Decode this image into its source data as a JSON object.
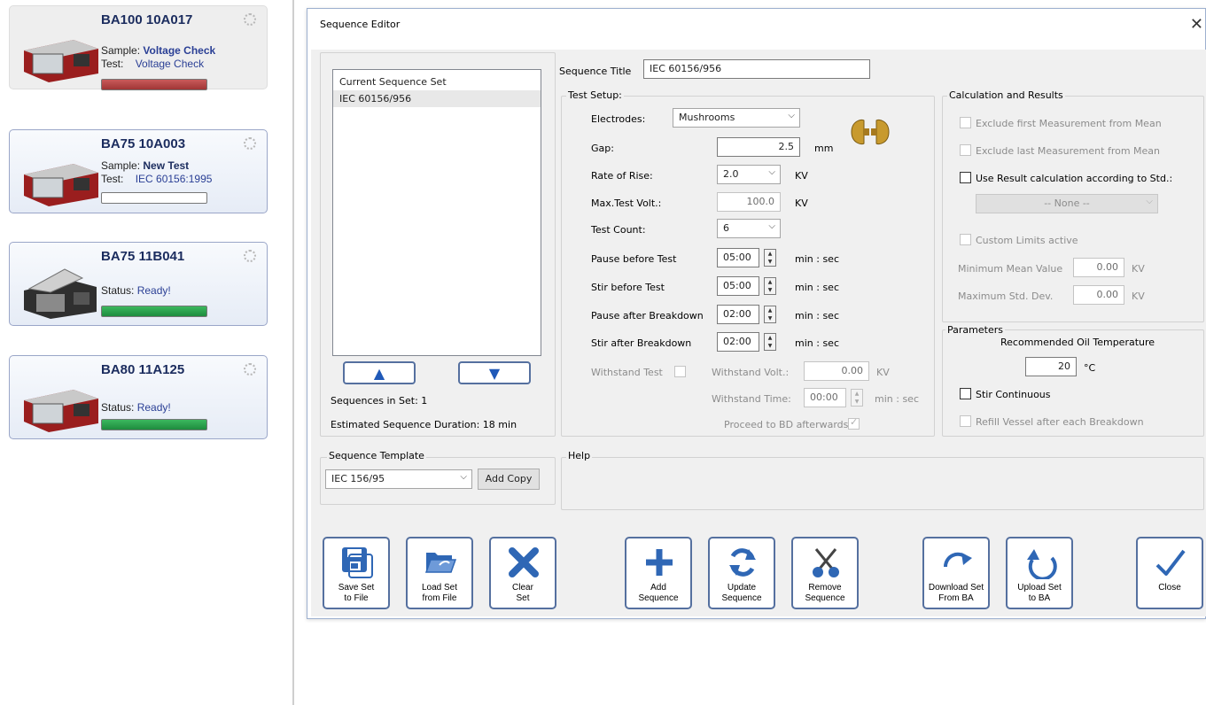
{
  "devices": [
    {
      "name": "BA100 10A017",
      "line1_label": "Sample:",
      "line1_value": "Voltage Check",
      "line2_label": "Test:",
      "line2_value": "Voltage Check",
      "status_color": "#b04040"
    },
    {
      "name": "BA75 10A003",
      "line1_label": "Sample:",
      "line1_value": "New Test",
      "line2_label": "Test:",
      "line2_value": "IEC 60156:1995",
      "status_color": "#ffffff"
    },
    {
      "name": "BA75 11B041",
      "status_label": "Status:",
      "status_value": "Ready!",
      "status_color": "#27a24a"
    },
    {
      "name": "BA80 11A125",
      "status_label": "Status:",
      "status_value": "Ready!",
      "status_color": "#27a24a"
    }
  ],
  "dialog": {
    "title": "Sequence Editor",
    "close_glyph": "✕",
    "list": {
      "header": "Current Sequence Set",
      "items": [
        "IEC 60156/956"
      ],
      "sequences_in_set": "Sequences in Set:  1",
      "estimated_duration": "Estimated Sequence Duration: 18 min"
    },
    "template": {
      "legend": "Sequence Template",
      "selected": "IEC 156/95",
      "add_copy": "Add Copy"
    },
    "sequence_title_label": "Sequence Title",
    "sequence_title_value": "IEC 60156/956",
    "test_setup": {
      "legend": "Test Setup:",
      "electrodes_label": "Electrodes:",
      "electrodes_value": "Mushrooms",
      "gap_label": "Gap:",
      "gap_value": "2.5",
      "gap_unit": "mm",
      "rate_label": "Rate of Rise:",
      "rate_value": "2.0",
      "rate_unit": "KV",
      "maxvolt_label": "Max.Test Volt.:",
      "maxvolt_value": "100.0",
      "maxvolt_unit": "KV",
      "count_label": "Test Count:",
      "count_value": "6",
      "pause_before_label": "Pause before Test",
      "pause_before_value": "05:00",
      "stir_before_label": "Stir before Test",
      "stir_before_value": "05:00",
      "pause_after_label": "Pause after Breakdown",
      "pause_after_value": "02:00",
      "stir_after_label": "Stir after Breakdown",
      "stir_after_value": "02:00",
      "time_unit": "min : sec",
      "withstand_label": "Withstand Test",
      "withstand_volt_label": "Withstand Volt.:",
      "withstand_volt_value": "0.00",
      "withstand_volt_unit": "KV",
      "withstand_time_label": "Withstand Time:",
      "withstand_time_value": "00:00",
      "withstand_time_unit": "min : sec",
      "proceed_label": "Proceed to BD afterwards"
    },
    "calc": {
      "legend": "Calculation and Results",
      "exclude_first": "Exclude first Measurement from Mean",
      "exclude_last": "Exclude last Measurement from Mean",
      "use_std": "Use Result calculation according to Std.:",
      "std_value": "-- None --",
      "custom_limits": "Custom Limits active",
      "min_mean_label": "Minimum Mean Value",
      "min_mean_value": "0.00",
      "max_std_label": "Maximum Std. Dev.",
      "max_std_value": "0.00",
      "unit": "KV"
    },
    "params": {
      "legend": "Parameters",
      "oil_temp_label": "Recommended Oil Temperature",
      "oil_temp_value": "20",
      "oil_temp_unit": "°C",
      "stir_cont": "Stir Continuous",
      "refill": "Refill Vessel after each Breakdown"
    },
    "help_legend": "Help",
    "toolbar": [
      {
        "label": "Save Set\nto File",
        "icon": "save-icon"
      },
      {
        "label": "Load Set\nfrom File",
        "icon": "folder-open-icon"
      },
      {
        "label": "Clear\nSet",
        "icon": "clear-x-icon"
      },
      {
        "label": "Add\nSequence",
        "icon": "plus-icon"
      },
      {
        "label": "Update\nSequence",
        "icon": "refresh-icon"
      },
      {
        "label": "Remove\nSequence",
        "icon": "scissors-icon"
      },
      {
        "label": "Download Set\nFrom BA",
        "icon": "download-arrow-icon"
      },
      {
        "label": "Upload Set\nto BA",
        "icon": "upload-arrow-icon"
      },
      {
        "label": "Close",
        "icon": "checkmark-icon"
      }
    ]
  }
}
